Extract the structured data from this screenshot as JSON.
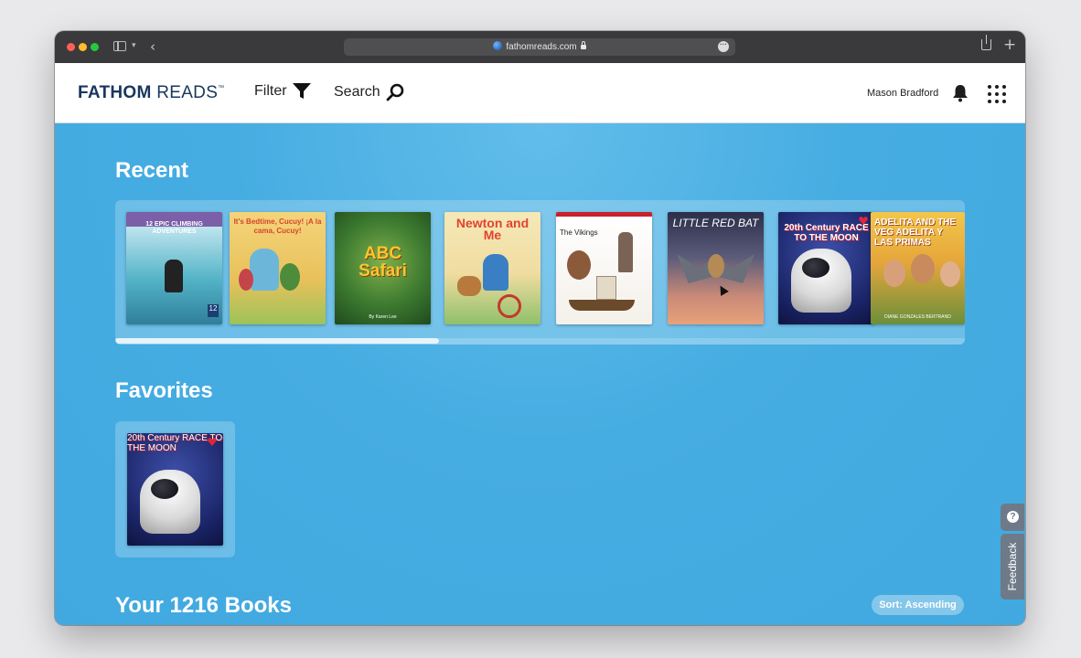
{
  "browser": {
    "url": "fathomreads.com",
    "icons": [
      "sidebar-icon",
      "chevron-down-icon",
      "back-icon",
      "globe-icon",
      "lock-icon",
      "more-icon",
      "share-icon",
      "plus-icon"
    ]
  },
  "header": {
    "logo_fathom": "FATHOM",
    "logo_reads": "READS",
    "logo_tm": "™",
    "filter_label": "Filter",
    "search_label": "Search",
    "user_name": "Mason Bradford",
    "icons": [
      "filter-icon",
      "search-icon",
      "bell-icon",
      "apps-grid-icon"
    ]
  },
  "sections": {
    "recent_title": "Recent",
    "favorites_title": "Favorites",
    "books_title": "Your 1216 Books",
    "sort_label": "Sort: Ascending"
  },
  "recent_books": [
    {
      "title": "12 EPIC CLIMBING ADVENTURES",
      "badge": "12"
    },
    {
      "title": "It's Bedtime, Cucuy! ¡A la cama, Cucuy!"
    },
    {
      "title": "ABC Safari",
      "author": "By Karen Lee"
    },
    {
      "title": "Newton and Me"
    },
    {
      "title": "The Vikings"
    },
    {
      "title": "LITTLE RED BAT"
    },
    {
      "title": "20th Century RACE TO THE MOON"
    },
    {
      "title": "ADELITA AND THE VEG ADELITA Y LAS PRIMAS",
      "author": "DIANE GONZALES BERTRAND"
    }
  ],
  "favorite_books": [
    {
      "title": "20th Century RACE TO THE MOON"
    }
  ],
  "side_tabs": {
    "help_icon": "question-icon",
    "feedback_label": "Feedback"
  },
  "colors": {
    "background": "#41a9e0",
    "logo": "#17375e",
    "header_bg": "#ffffff"
  }
}
